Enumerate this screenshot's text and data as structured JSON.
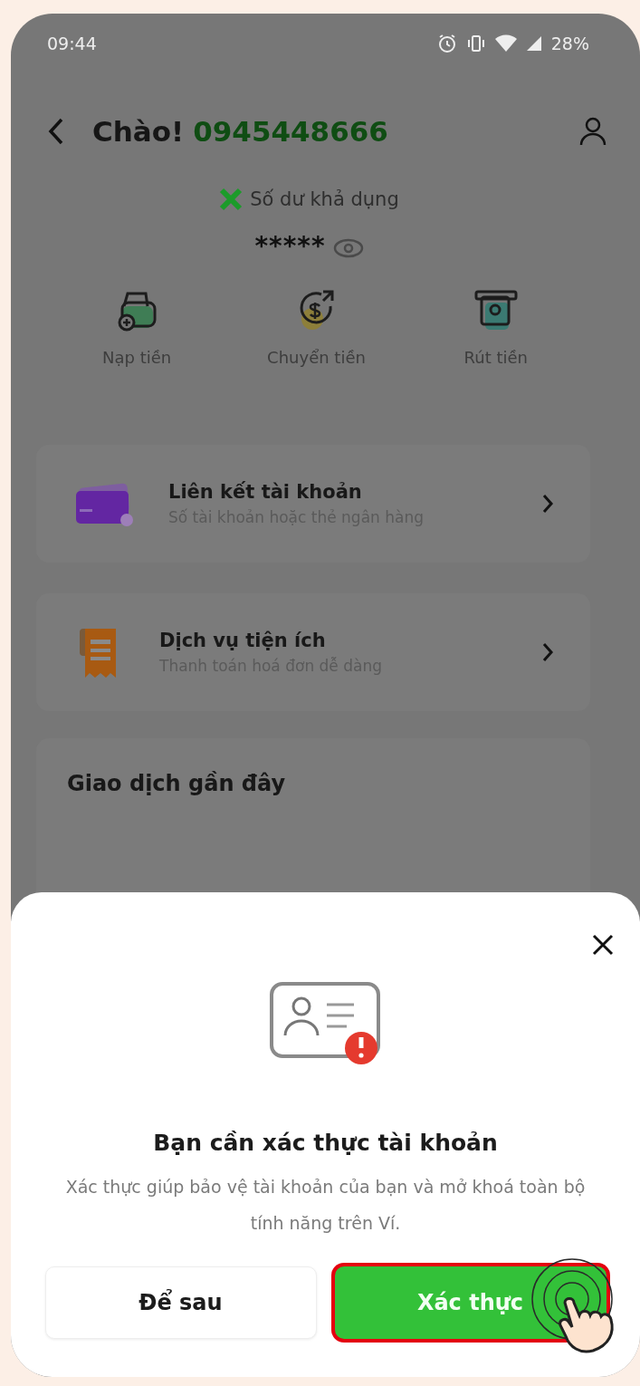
{
  "status_bar": {
    "time": "09:44",
    "battery": "28%"
  },
  "header": {
    "greeting": "Chào!",
    "phone": "0945448666"
  },
  "balance": {
    "label": "Số dư khả dụng",
    "value": "*****"
  },
  "actions": [
    {
      "label": "Nạp tiền",
      "kind": "topup"
    },
    {
      "label": "Chuyển tiền",
      "kind": "transfer"
    },
    {
      "label": "Rút tiền",
      "kind": "withdraw"
    }
  ],
  "menu": [
    {
      "title": "Liên kết tài khoản",
      "subtitle": "Số tài khoản hoặc thẻ ngân hàng",
      "kind": "card"
    },
    {
      "title": "Dịch vụ tiện ích",
      "subtitle": "Thanh toán hoá đơn dễ dàng",
      "kind": "bill"
    }
  ],
  "recent": {
    "title": "Giao dịch gần đây"
  },
  "sheet": {
    "title": "Bạn cần xác thực tài khoản",
    "message": "Xác thực giúp bảo vệ tài khoản của bạn và mở khoá toàn bộ tính năng trên Ví.",
    "buttons": [
      {
        "label": "Để sau",
        "kind": "secondary"
      },
      {
        "label": "Xác thực",
        "kind": "primary"
      }
    ]
  }
}
